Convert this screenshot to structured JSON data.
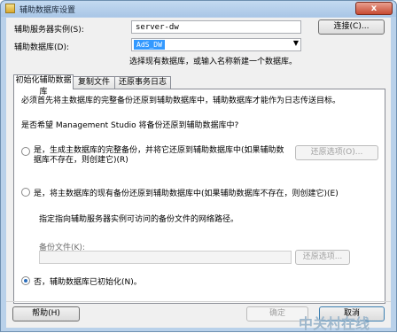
{
  "window": {
    "title": "辅助数据库设置",
    "close": "x"
  },
  "server": {
    "label": "辅助服务器实例(S):",
    "value": "server-dw",
    "connect_button": "连接(C)..."
  },
  "database": {
    "label": "辅助数据库(D):",
    "selected": "AdS_DW",
    "hint": "选择现有数据库，或输入名称新建一个数据库。"
  },
  "tabs": [
    "初始化辅助数据库",
    "复制文件",
    "还原事务日志"
  ],
  "init_tab": {
    "intro": "必须首先将主数据库的完整备份还原到辅助数据库中，辅助数据库才能作为日志传送目标。",
    "question": "是否希望 Management Studio 将备份还原到辅助数据库中?",
    "option1": "是，生成主数据库的完整备份，并将它还原到辅助数据库中(如果辅助数据库不存在，则创建它)(R)",
    "option1_button": "还原选项(O)...",
    "option2": "是，将主数据库的现有备份还原到辅助数据库中(如果辅助数据库不存在，则创建它)(E)",
    "option2_hint": "指定指向辅助服务器实例可访问的备份文件的网络路径。",
    "backup_label": "备份文件(K):",
    "backup_value": "",
    "option2_button": "还原选项...",
    "option3": "否，辅助数据库已初始化(N)。"
  },
  "footer": {
    "help": "帮助(H)",
    "ok": "确定",
    "cancel": "取消"
  },
  "watermark": "中关村在线"
}
